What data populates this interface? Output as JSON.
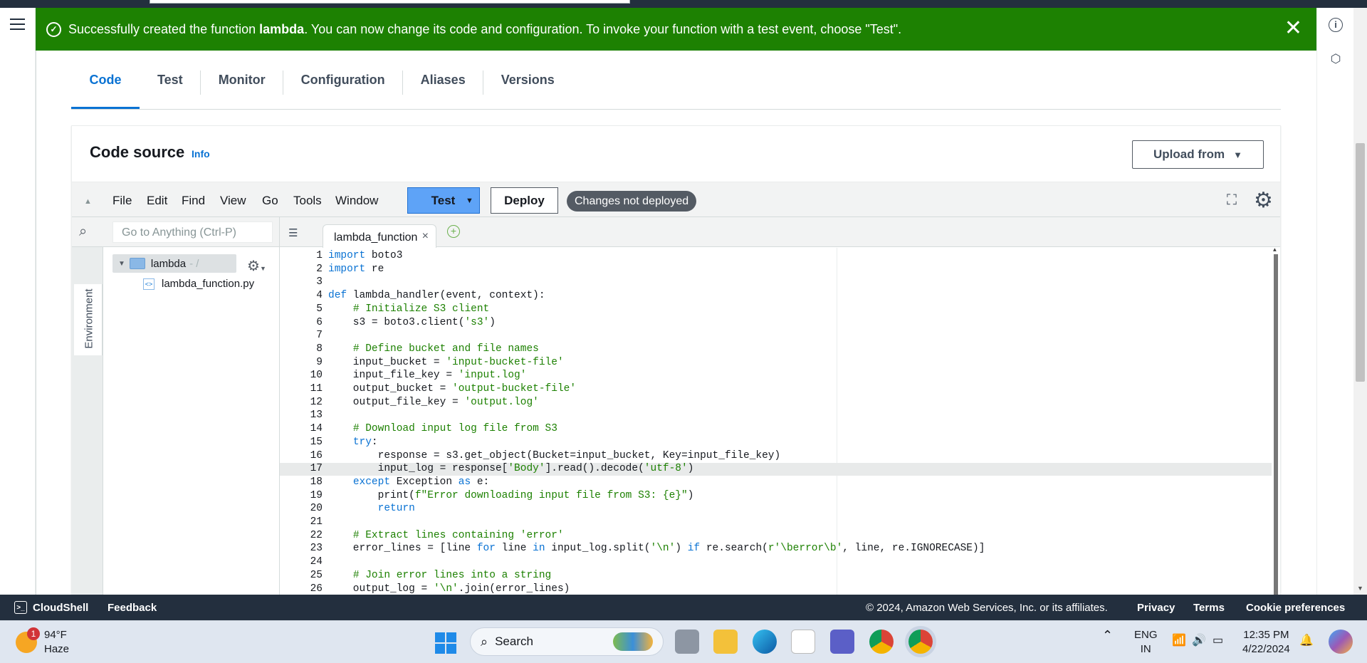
{
  "flash": {
    "prefix": "Successfully created the function ",
    "function_name": "lambda",
    "suffix": ". You can now change its code and configuration. To invoke your function with a test event, choose \"Test\"."
  },
  "tabs": [
    "Code",
    "Test",
    "Monitor",
    "Configuration",
    "Aliases",
    "Versions"
  ],
  "panel": {
    "title": "Code source",
    "info": "Info",
    "upload": "Upload from"
  },
  "toolbar": {
    "menus": [
      "File",
      "Edit",
      "Find",
      "View",
      "Go",
      "Tools",
      "Window"
    ],
    "test": "Test",
    "deploy": "Deploy",
    "status": "Changes not deployed"
  },
  "navigator": {
    "search_placeholder": "Go to Anything (Ctrl-P)",
    "environment": "Environment",
    "folder": "lambda",
    "folder_suffix": "- /",
    "file": "lambda_function.py"
  },
  "editor": {
    "tab": "lambda_function",
    "highlight_line": 17,
    "lines": [
      "import boto3",
      "import re",
      "",
      "def lambda_handler(event, context):",
      "    # Initialize S3 client",
      "    s3 = boto3.client('s3')",
      "",
      "    # Define bucket and file names",
      "    input_bucket = 'input-bucket-file'",
      "    input_file_key = 'input.log'",
      "    output_bucket = 'output-bucket-file'",
      "    output_file_key = 'output.log'",
      "",
      "    # Download input log file from S3",
      "    try:",
      "        response = s3.get_object(Bucket=input_bucket, Key=input_file_key)",
      "        input_log = response['Body'].read().decode('utf-8')",
      "    except Exception as e:",
      "        print(f\"Error downloading input file from S3: {e}\")",
      "        return",
      "",
      "    # Extract lines containing 'error'",
      "    error_lines = [line for line in input_log.split('\\n') if re.search(r'\\berror\\b', line, re.IGNORECASE)]",
      "",
      "    # Join error lines into a string",
      "    output_log = '\\n'.join(error_lines)"
    ]
  },
  "footer": {
    "cloudshell": "CloudShell",
    "feedback": "Feedback",
    "copyright": "© 2024, Amazon Web Services, Inc. or its affiliates.",
    "privacy": "Privacy",
    "terms": "Terms",
    "cookies": "Cookie preferences"
  },
  "taskbar": {
    "temp": "94°F",
    "weather": "Haze",
    "badge": "1",
    "search": "Search",
    "lang": "ENG",
    "region": "IN",
    "time": "12:35 PM",
    "date": "4/22/2024"
  },
  "colors": {
    "flash_green": "#1d8102",
    "accent_blue": "#0972d3",
    "test_button": "#5ea3f7",
    "aws_dark": "#232f3e"
  }
}
